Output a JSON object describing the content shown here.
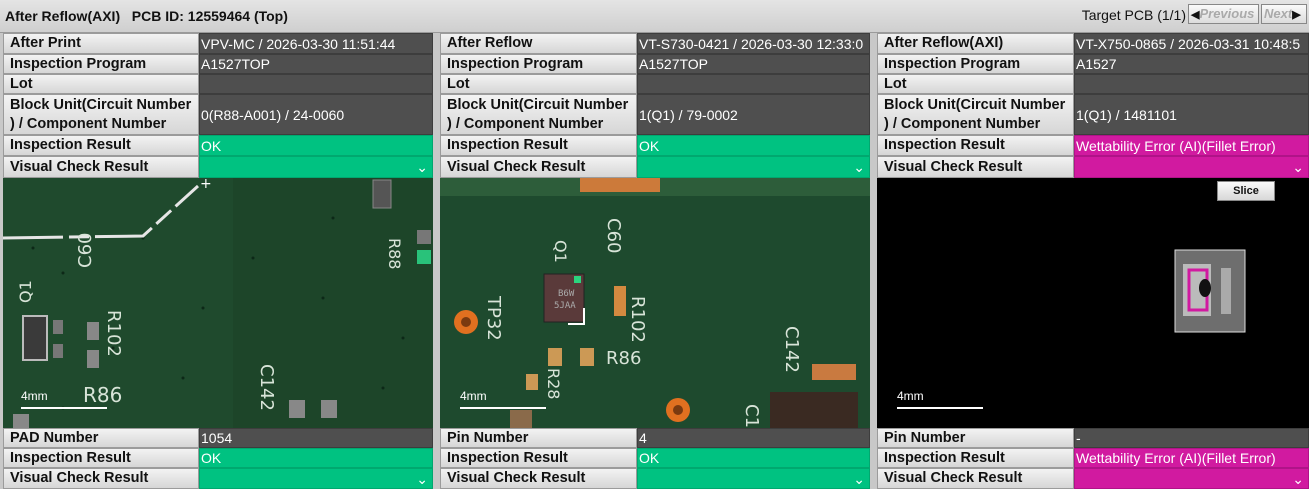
{
  "header": {
    "title": "After Reflow(AXI)   PCB ID: 12559464 (Top)",
    "target": "Target PCB (1/1)",
    "previous": "Previous",
    "next": "Next"
  },
  "panels": [
    {
      "stage_label": "After Print",
      "stage_value": "VPV-MC / 2026-03-30 11:51:44",
      "program_label": "Inspection Program",
      "program_value": "A1527TOP",
      "lot_label": "Lot",
      "lot_value": "",
      "block_label": "Block Unit(Circuit Number ) / Component Number",
      "block_value": "0(R88-A001) / 24-0060",
      "result_label": "Inspection Result",
      "result_value": "OK",
      "visual_label": "Visual Check Result",
      "scale": "4mm",
      "silk": [
        "C60",
        "R88",
        "Q1",
        "R102",
        "C142",
        "R86"
      ],
      "pin_label": "PAD Number",
      "pin_value": "1054",
      "result2_label": "Inspection Result",
      "result2_value": "OK",
      "visual2_label": "Visual Check Result"
    },
    {
      "stage_label": "After Reflow",
      "stage_value": "VT-S730-0421 / 2026-03-30 12:33:0",
      "program_label": "Inspection Program",
      "program_value": "A1527TOP",
      "lot_label": "Lot",
      "lot_value": "",
      "block_label": "Block Unit(Circuit Number ) / Component Number",
      "block_value": "1(Q1) / 79-0002",
      "result_label": "Inspection Result",
      "result_value": "OK",
      "visual_label": "Visual Check Result",
      "scale": "4mm",
      "silk": [
        "C60",
        "Q1",
        "R102",
        "TP32",
        "R86",
        "C142",
        "R28",
        "C1"
      ],
      "pin_label": "Pin Number",
      "pin_value": "4",
      "result2_label": "Inspection Result",
      "result2_value": "OK",
      "visual2_label": "Visual Check Result"
    },
    {
      "stage_label": "After Reflow(AXI)",
      "stage_value": "VT-X750-0865 / 2026-03-31 10:48:5",
      "program_label": "Inspection Program",
      "program_value": "A1527",
      "lot_label": "Lot",
      "lot_value": "",
      "block_label": "Block Unit(Circuit Number ) / Component Number",
      "block_value": "1(Q1) / 1481101",
      "result_label": "Inspection Result",
      "result_value": "Wettability Error (AI)(Fillet Error)",
      "visual_label": "Visual Check Result",
      "scale": "4mm",
      "slice": "Slice",
      "pin_label": "Pin Number",
      "pin_value": "-",
      "result2_label": "Inspection Result",
      "result2_value": "Wettability Error (AI)(Fillet Error)",
      "visual2_label": "Visual Check Result"
    }
  ],
  "icons": {
    "dropdown": "chevron-down-icon",
    "prev": "triangle-left-icon",
    "next": "triangle-right-icon"
  },
  "colors": {
    "ok": "#00c281",
    "error": "#d11aa0",
    "pcb": "#1f4a2d"
  }
}
